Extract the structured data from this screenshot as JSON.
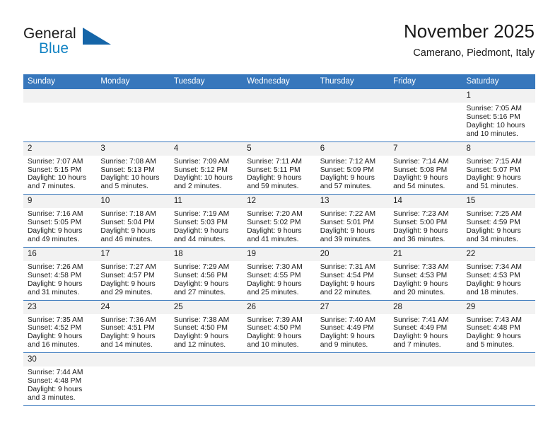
{
  "brand": {
    "name_line1": "General",
    "name_line2": "Blue",
    "logo_icon": "triangle-flag-icon",
    "color_primary": "#1283c3",
    "color_header": "#3777bc"
  },
  "header": {
    "title": "November 2025",
    "subtitle": "Camerano, Piedmont, Italy"
  },
  "weekday_headers": [
    "Sunday",
    "Monday",
    "Tuesday",
    "Wednesday",
    "Thursday",
    "Friday",
    "Saturday"
  ],
  "weeks": [
    [
      {
        "day": "",
        "sunrise": "",
        "sunset": "",
        "daylight1": "",
        "daylight2": "",
        "blank": true
      },
      {
        "day": "",
        "sunrise": "",
        "sunset": "",
        "daylight1": "",
        "daylight2": "",
        "blank": true
      },
      {
        "day": "",
        "sunrise": "",
        "sunset": "",
        "daylight1": "",
        "daylight2": "",
        "blank": true
      },
      {
        "day": "",
        "sunrise": "",
        "sunset": "",
        "daylight1": "",
        "daylight2": "",
        "blank": true
      },
      {
        "day": "",
        "sunrise": "",
        "sunset": "",
        "daylight1": "",
        "daylight2": "",
        "blank": true
      },
      {
        "day": "",
        "sunrise": "",
        "sunset": "",
        "daylight1": "",
        "daylight2": "",
        "blank": true
      },
      {
        "day": "1",
        "sunrise": "Sunrise: 7:05 AM",
        "sunset": "Sunset: 5:16 PM",
        "daylight1": "Daylight: 10 hours",
        "daylight2": "and 10 minutes.",
        "blank": false
      }
    ],
    [
      {
        "day": "2",
        "sunrise": "Sunrise: 7:07 AM",
        "sunset": "Sunset: 5:15 PM",
        "daylight1": "Daylight: 10 hours",
        "daylight2": "and 7 minutes.",
        "blank": false
      },
      {
        "day": "3",
        "sunrise": "Sunrise: 7:08 AM",
        "sunset": "Sunset: 5:13 PM",
        "daylight1": "Daylight: 10 hours",
        "daylight2": "and 5 minutes.",
        "blank": false
      },
      {
        "day": "4",
        "sunrise": "Sunrise: 7:09 AM",
        "sunset": "Sunset: 5:12 PM",
        "daylight1": "Daylight: 10 hours",
        "daylight2": "and 2 minutes.",
        "blank": false
      },
      {
        "day": "5",
        "sunrise": "Sunrise: 7:11 AM",
        "sunset": "Sunset: 5:11 PM",
        "daylight1": "Daylight: 9 hours",
        "daylight2": "and 59 minutes.",
        "blank": false
      },
      {
        "day": "6",
        "sunrise": "Sunrise: 7:12 AM",
        "sunset": "Sunset: 5:09 PM",
        "daylight1": "Daylight: 9 hours",
        "daylight2": "and 57 minutes.",
        "blank": false
      },
      {
        "day": "7",
        "sunrise": "Sunrise: 7:14 AM",
        "sunset": "Sunset: 5:08 PM",
        "daylight1": "Daylight: 9 hours",
        "daylight2": "and 54 minutes.",
        "blank": false
      },
      {
        "day": "8",
        "sunrise": "Sunrise: 7:15 AM",
        "sunset": "Sunset: 5:07 PM",
        "daylight1": "Daylight: 9 hours",
        "daylight2": "and 51 minutes.",
        "blank": false
      }
    ],
    [
      {
        "day": "9",
        "sunrise": "Sunrise: 7:16 AM",
        "sunset": "Sunset: 5:05 PM",
        "daylight1": "Daylight: 9 hours",
        "daylight2": "and 49 minutes.",
        "blank": false
      },
      {
        "day": "10",
        "sunrise": "Sunrise: 7:18 AM",
        "sunset": "Sunset: 5:04 PM",
        "daylight1": "Daylight: 9 hours",
        "daylight2": "and 46 minutes.",
        "blank": false
      },
      {
        "day": "11",
        "sunrise": "Sunrise: 7:19 AM",
        "sunset": "Sunset: 5:03 PM",
        "daylight1": "Daylight: 9 hours",
        "daylight2": "and 44 minutes.",
        "blank": false
      },
      {
        "day": "12",
        "sunrise": "Sunrise: 7:20 AM",
        "sunset": "Sunset: 5:02 PM",
        "daylight1": "Daylight: 9 hours",
        "daylight2": "and 41 minutes.",
        "blank": false
      },
      {
        "day": "13",
        "sunrise": "Sunrise: 7:22 AM",
        "sunset": "Sunset: 5:01 PM",
        "daylight1": "Daylight: 9 hours",
        "daylight2": "and 39 minutes.",
        "blank": false
      },
      {
        "day": "14",
        "sunrise": "Sunrise: 7:23 AM",
        "sunset": "Sunset: 5:00 PM",
        "daylight1": "Daylight: 9 hours",
        "daylight2": "and 36 minutes.",
        "blank": false
      },
      {
        "day": "15",
        "sunrise": "Sunrise: 7:25 AM",
        "sunset": "Sunset: 4:59 PM",
        "daylight1": "Daylight: 9 hours",
        "daylight2": "and 34 minutes.",
        "blank": false
      }
    ],
    [
      {
        "day": "16",
        "sunrise": "Sunrise: 7:26 AM",
        "sunset": "Sunset: 4:58 PM",
        "daylight1": "Daylight: 9 hours",
        "daylight2": "and 31 minutes.",
        "blank": false
      },
      {
        "day": "17",
        "sunrise": "Sunrise: 7:27 AM",
        "sunset": "Sunset: 4:57 PM",
        "daylight1": "Daylight: 9 hours",
        "daylight2": "and 29 minutes.",
        "blank": false
      },
      {
        "day": "18",
        "sunrise": "Sunrise: 7:29 AM",
        "sunset": "Sunset: 4:56 PM",
        "daylight1": "Daylight: 9 hours",
        "daylight2": "and 27 minutes.",
        "blank": false
      },
      {
        "day": "19",
        "sunrise": "Sunrise: 7:30 AM",
        "sunset": "Sunset: 4:55 PM",
        "daylight1": "Daylight: 9 hours",
        "daylight2": "and 25 minutes.",
        "blank": false
      },
      {
        "day": "20",
        "sunrise": "Sunrise: 7:31 AM",
        "sunset": "Sunset: 4:54 PM",
        "daylight1": "Daylight: 9 hours",
        "daylight2": "and 22 minutes.",
        "blank": false
      },
      {
        "day": "21",
        "sunrise": "Sunrise: 7:33 AM",
        "sunset": "Sunset: 4:53 PM",
        "daylight1": "Daylight: 9 hours",
        "daylight2": "and 20 minutes.",
        "blank": false
      },
      {
        "day": "22",
        "sunrise": "Sunrise: 7:34 AM",
        "sunset": "Sunset: 4:53 PM",
        "daylight1": "Daylight: 9 hours",
        "daylight2": "and 18 minutes.",
        "blank": false
      }
    ],
    [
      {
        "day": "23",
        "sunrise": "Sunrise: 7:35 AM",
        "sunset": "Sunset: 4:52 PM",
        "daylight1": "Daylight: 9 hours",
        "daylight2": "and 16 minutes.",
        "blank": false
      },
      {
        "day": "24",
        "sunrise": "Sunrise: 7:36 AM",
        "sunset": "Sunset: 4:51 PM",
        "daylight1": "Daylight: 9 hours",
        "daylight2": "and 14 minutes.",
        "blank": false
      },
      {
        "day": "25",
        "sunrise": "Sunrise: 7:38 AM",
        "sunset": "Sunset: 4:50 PM",
        "daylight1": "Daylight: 9 hours",
        "daylight2": "and 12 minutes.",
        "blank": false
      },
      {
        "day": "26",
        "sunrise": "Sunrise: 7:39 AM",
        "sunset": "Sunset: 4:50 PM",
        "daylight1": "Daylight: 9 hours",
        "daylight2": "and 10 minutes.",
        "blank": false
      },
      {
        "day": "27",
        "sunrise": "Sunrise: 7:40 AM",
        "sunset": "Sunset: 4:49 PM",
        "daylight1": "Daylight: 9 hours",
        "daylight2": "and 9 minutes.",
        "blank": false
      },
      {
        "day": "28",
        "sunrise": "Sunrise: 7:41 AM",
        "sunset": "Sunset: 4:49 PM",
        "daylight1": "Daylight: 9 hours",
        "daylight2": "and 7 minutes.",
        "blank": false
      },
      {
        "day": "29",
        "sunrise": "Sunrise: 7:43 AM",
        "sunset": "Sunset: 4:48 PM",
        "daylight1": "Daylight: 9 hours",
        "daylight2": "and 5 minutes.",
        "blank": false
      }
    ],
    [
      {
        "day": "30",
        "sunrise": "Sunrise: 7:44 AM",
        "sunset": "Sunset: 4:48 PM",
        "daylight1": "Daylight: 9 hours",
        "daylight2": "and 3 minutes.",
        "blank": false
      },
      {
        "day": "",
        "sunrise": "",
        "sunset": "",
        "daylight1": "",
        "daylight2": "",
        "blank": true
      },
      {
        "day": "",
        "sunrise": "",
        "sunset": "",
        "daylight1": "",
        "daylight2": "",
        "blank": true
      },
      {
        "day": "",
        "sunrise": "",
        "sunset": "",
        "daylight1": "",
        "daylight2": "",
        "blank": true
      },
      {
        "day": "",
        "sunrise": "",
        "sunset": "",
        "daylight1": "",
        "daylight2": "",
        "blank": true
      },
      {
        "day": "",
        "sunrise": "",
        "sunset": "",
        "daylight1": "",
        "daylight2": "",
        "blank": true
      },
      {
        "day": "",
        "sunrise": "",
        "sunset": "",
        "daylight1": "",
        "daylight2": "",
        "blank": true
      }
    ]
  ]
}
